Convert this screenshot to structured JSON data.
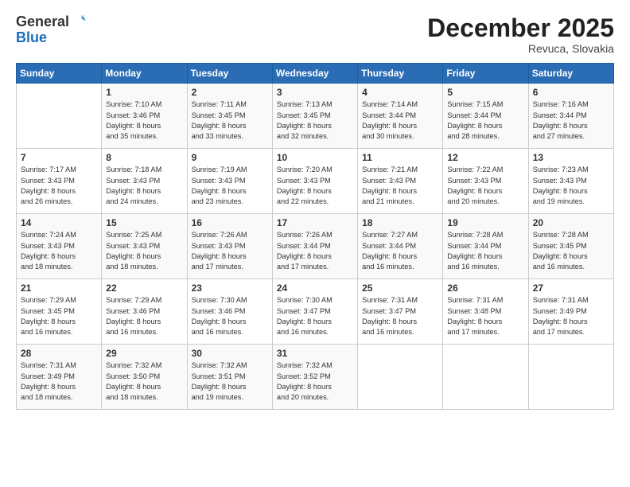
{
  "logo": {
    "general": "General",
    "blue": "Blue"
  },
  "header": {
    "month": "December 2025",
    "location": "Revuca, Slovakia"
  },
  "weekdays": [
    "Sunday",
    "Monday",
    "Tuesday",
    "Wednesday",
    "Thursday",
    "Friday",
    "Saturday"
  ],
  "weeks": [
    [
      {
        "day": "",
        "text": ""
      },
      {
        "day": "1",
        "text": "Sunrise: 7:10 AM\nSunset: 3:46 PM\nDaylight: 8 hours\nand 35 minutes."
      },
      {
        "day": "2",
        "text": "Sunrise: 7:11 AM\nSunset: 3:45 PM\nDaylight: 8 hours\nand 33 minutes."
      },
      {
        "day": "3",
        "text": "Sunrise: 7:13 AM\nSunset: 3:45 PM\nDaylight: 8 hours\nand 32 minutes."
      },
      {
        "day": "4",
        "text": "Sunrise: 7:14 AM\nSunset: 3:44 PM\nDaylight: 8 hours\nand 30 minutes."
      },
      {
        "day": "5",
        "text": "Sunrise: 7:15 AM\nSunset: 3:44 PM\nDaylight: 8 hours\nand 28 minutes."
      },
      {
        "day": "6",
        "text": "Sunrise: 7:16 AM\nSunset: 3:44 PM\nDaylight: 8 hours\nand 27 minutes."
      }
    ],
    [
      {
        "day": "7",
        "text": "Sunrise: 7:17 AM\nSunset: 3:43 PM\nDaylight: 8 hours\nand 26 minutes."
      },
      {
        "day": "8",
        "text": "Sunrise: 7:18 AM\nSunset: 3:43 PM\nDaylight: 8 hours\nand 24 minutes."
      },
      {
        "day": "9",
        "text": "Sunrise: 7:19 AM\nSunset: 3:43 PM\nDaylight: 8 hours\nand 23 minutes."
      },
      {
        "day": "10",
        "text": "Sunrise: 7:20 AM\nSunset: 3:43 PM\nDaylight: 8 hours\nand 22 minutes."
      },
      {
        "day": "11",
        "text": "Sunrise: 7:21 AM\nSunset: 3:43 PM\nDaylight: 8 hours\nand 21 minutes."
      },
      {
        "day": "12",
        "text": "Sunrise: 7:22 AM\nSunset: 3:43 PM\nDaylight: 8 hours\nand 20 minutes."
      },
      {
        "day": "13",
        "text": "Sunrise: 7:23 AM\nSunset: 3:43 PM\nDaylight: 8 hours\nand 19 minutes."
      }
    ],
    [
      {
        "day": "14",
        "text": "Sunrise: 7:24 AM\nSunset: 3:43 PM\nDaylight: 8 hours\nand 18 minutes."
      },
      {
        "day": "15",
        "text": "Sunrise: 7:25 AM\nSunset: 3:43 PM\nDaylight: 8 hours\nand 18 minutes."
      },
      {
        "day": "16",
        "text": "Sunrise: 7:26 AM\nSunset: 3:43 PM\nDaylight: 8 hours\nand 17 minutes."
      },
      {
        "day": "17",
        "text": "Sunrise: 7:26 AM\nSunset: 3:44 PM\nDaylight: 8 hours\nand 17 minutes."
      },
      {
        "day": "18",
        "text": "Sunrise: 7:27 AM\nSunset: 3:44 PM\nDaylight: 8 hours\nand 16 minutes."
      },
      {
        "day": "19",
        "text": "Sunrise: 7:28 AM\nSunset: 3:44 PM\nDaylight: 8 hours\nand 16 minutes."
      },
      {
        "day": "20",
        "text": "Sunrise: 7:28 AM\nSunset: 3:45 PM\nDaylight: 8 hours\nand 16 minutes."
      }
    ],
    [
      {
        "day": "21",
        "text": "Sunrise: 7:29 AM\nSunset: 3:45 PM\nDaylight: 8 hours\nand 16 minutes."
      },
      {
        "day": "22",
        "text": "Sunrise: 7:29 AM\nSunset: 3:46 PM\nDaylight: 8 hours\nand 16 minutes."
      },
      {
        "day": "23",
        "text": "Sunrise: 7:30 AM\nSunset: 3:46 PM\nDaylight: 8 hours\nand 16 minutes."
      },
      {
        "day": "24",
        "text": "Sunrise: 7:30 AM\nSunset: 3:47 PM\nDaylight: 8 hours\nand 16 minutes."
      },
      {
        "day": "25",
        "text": "Sunrise: 7:31 AM\nSunset: 3:47 PM\nDaylight: 8 hours\nand 16 minutes."
      },
      {
        "day": "26",
        "text": "Sunrise: 7:31 AM\nSunset: 3:48 PM\nDaylight: 8 hours\nand 17 minutes."
      },
      {
        "day": "27",
        "text": "Sunrise: 7:31 AM\nSunset: 3:49 PM\nDaylight: 8 hours\nand 17 minutes."
      }
    ],
    [
      {
        "day": "28",
        "text": "Sunrise: 7:31 AM\nSunset: 3:49 PM\nDaylight: 8 hours\nand 18 minutes."
      },
      {
        "day": "29",
        "text": "Sunrise: 7:32 AM\nSunset: 3:50 PM\nDaylight: 8 hours\nand 18 minutes."
      },
      {
        "day": "30",
        "text": "Sunrise: 7:32 AM\nSunset: 3:51 PM\nDaylight: 8 hours\nand 19 minutes."
      },
      {
        "day": "31",
        "text": "Sunrise: 7:32 AM\nSunset: 3:52 PM\nDaylight: 8 hours\nand 20 minutes."
      },
      {
        "day": "",
        "text": ""
      },
      {
        "day": "",
        "text": ""
      },
      {
        "day": "",
        "text": ""
      }
    ]
  ]
}
